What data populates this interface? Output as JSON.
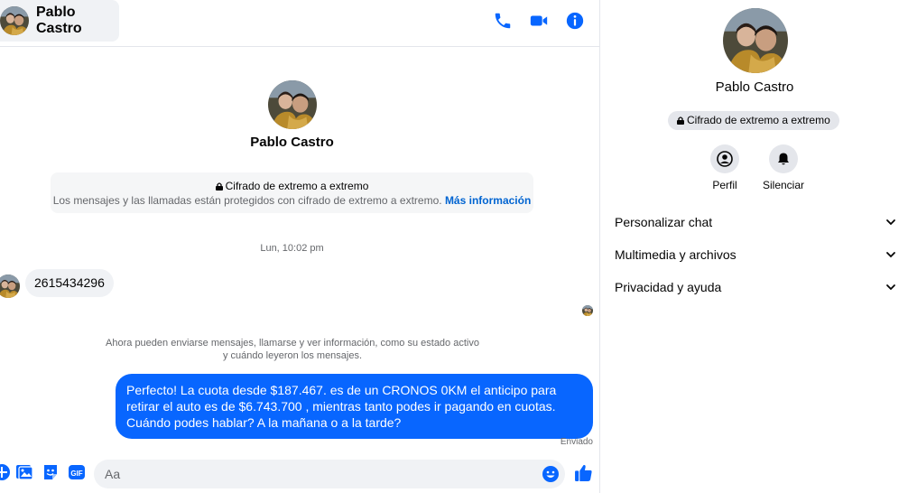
{
  "contact": {
    "name": "Pablo Castro"
  },
  "header": {
    "icons": [
      "phone-icon",
      "video-camera-icon",
      "info-icon"
    ]
  },
  "intro": {
    "name": "Pablo Castro",
    "e2e_title": "Cifrado de extremo a extremo",
    "e2e_text": "Los mensajes y las llamadas están protegidos con cifrado de extremo a extremo.",
    "e2e_link": "Más información"
  },
  "messages": {
    "timestamp": "Lun, 10:02 pm",
    "incoming": "2615434296",
    "active_note_line1": "Ahora pueden enviarse mensajes, llamarse y ver información, como su estado activo",
    "active_note_line2": "y cuándo leyeron los mensajes.",
    "outgoing": "Perfecto! La cuota desde $187.467. es de un CRONOS 0KM el anticipo para retirar el auto es de $6.743.700 , mientras tanto podes ir pagando en cuotas. Cuándo podes hablar? A la mañana o a la tarde?",
    "sent_status": "Enviado"
  },
  "composer": {
    "value": "",
    "placeholder": "Aa"
  },
  "info_panel": {
    "name": "Pablo Castro",
    "e2e_badge": "Cifrado de extremo a extremo",
    "profile_label": "Perfil",
    "mute_label": "Silenciar",
    "sections": [
      "Personalizar chat",
      "Multimedia y archivos",
      "Privacidad y ayuda"
    ]
  },
  "colors": {
    "accent": "#0866ff",
    "bubble_in": "#f0f2f5",
    "muted_text": "#65676b",
    "link": "#0064d1"
  }
}
